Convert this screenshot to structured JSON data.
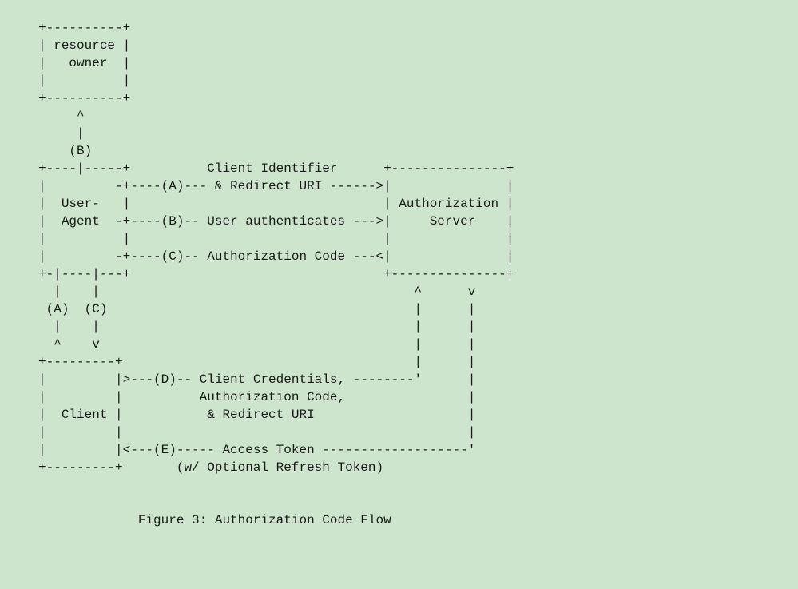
{
  "figure": {
    "caption": "Figure 3: Authorization Code Flow",
    "entities": {
      "resource_owner": "resource\n   owner",
      "user_agent": "User-\nAgent",
      "authorization_server": "Authorization\n    Server",
      "client": "Client"
    },
    "steps": {
      "A": "Client Identifier\n& Redirect URI",
      "B_up": "(B)",
      "B": "User authenticates",
      "C": "Authorization Code",
      "D": "Client Credentials,\nAuthorization Code,\n& Redirect URI",
      "E": "Access Token\n(w/ Optional Refresh Token)"
    },
    "ascii_lines": [
      "     +----------+",
      "     | resource |",
      "     |   owner  |",
      "     |          |",
      "     +----------+",
      "          ^",
      "          |",
      "         (B)",
      "     +----|-----+          Client Identifier      +---------------+",
      "     |         -+----(A)--- & Redirect URI ------>|               |",
      "     |  User-   |                                 | Authorization |",
      "     |  Agent  -+----(B)-- User authenticates --->|     Server    |",
      "     |          |                                 |               |",
      "     |         -+----(C)-- Authorization Code ---<|               |",
      "     +-|----|---+                                 +---------------+",
      "       |    |                                         ^      v",
      "      (A)  (C)                                        |      |",
      "       |    |                                         |      |",
      "       ^    v                                         |      |",
      "     +---------+                                      |      |",
      "     |         |>---(D)-- Client Credentials, --------'      |",
      "     |         |          Authorization Code,                |",
      "     |  Client |           & Redirect URI                    |",
      "     |         |                                             |",
      "     |         |<---(E)----- Access Token -------------------'",
      "     +---------+       (w/ Optional Refresh Token)",
      "",
      "",
      "                  Figure 3: Authorization Code Flow"
    ]
  }
}
